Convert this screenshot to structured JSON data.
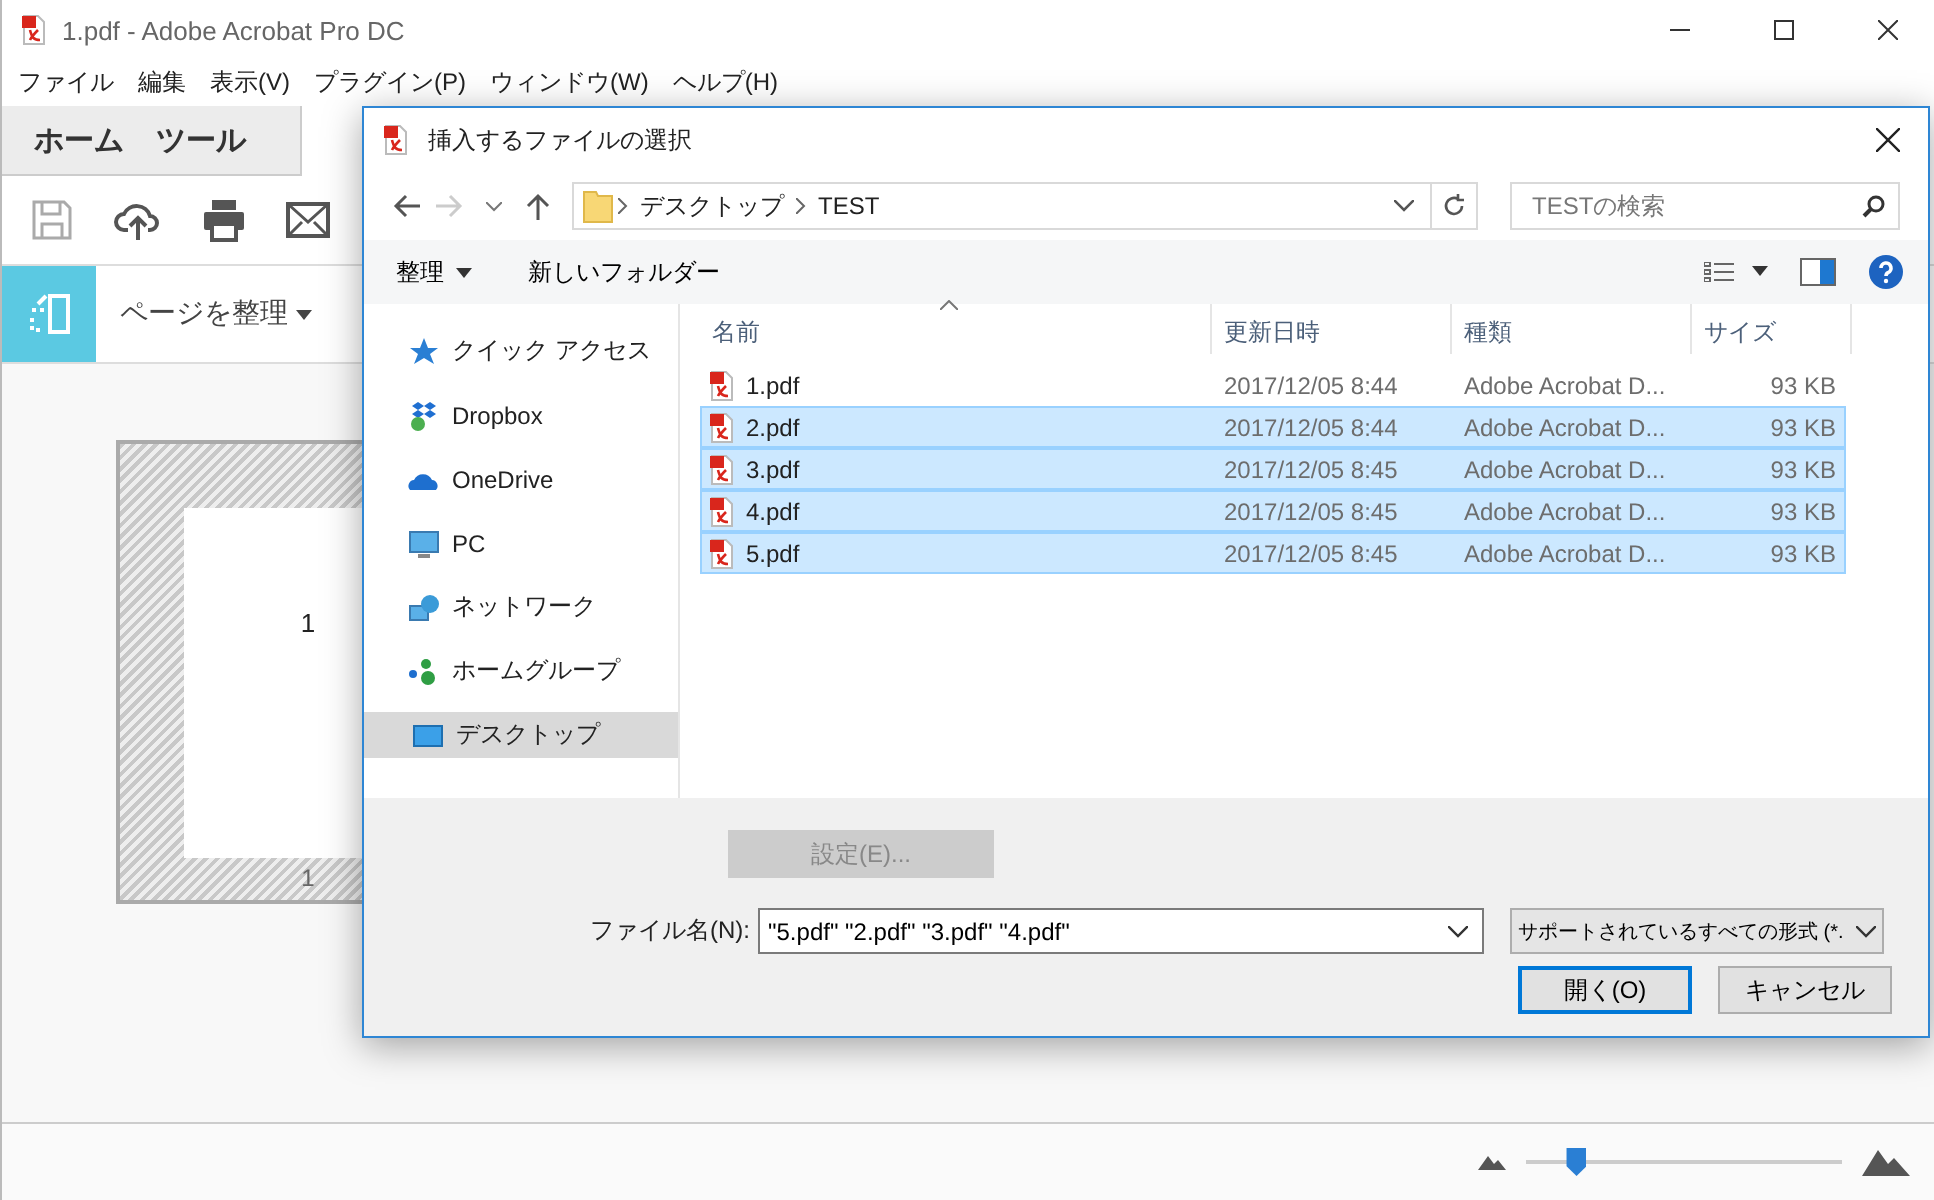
{
  "window": {
    "title": "1.pdf - Adobe Acrobat Pro DC"
  },
  "menu": [
    "ファイル",
    "編集",
    "表示(V)",
    "プラグイン(P)",
    "ウィンドウ(W)",
    "ヘルプ(H)"
  ],
  "tabs": [
    "ホーム",
    "ツール"
  ],
  "organize": {
    "label": "ページを整理"
  },
  "page_thumbnail": {
    "page_number": "1",
    "label": "1"
  },
  "dialog": {
    "title": "挿入するファイルの選択",
    "address": [
      "デスクトップ",
      "TEST"
    ],
    "search": {
      "placeholder": "TESTの検索"
    },
    "toolbar": {
      "organize": "整理",
      "new_folder": "新しいフォルダー"
    },
    "nav": [
      {
        "label": "クイック アクセス",
        "selected": false
      },
      {
        "label": "Dropbox",
        "selected": false
      },
      {
        "label": "OneDrive",
        "selected": false
      },
      {
        "label": "PC",
        "selected": false
      },
      {
        "label": "ネットワーク",
        "selected": false
      },
      {
        "label": "ホームグループ",
        "selected": false
      },
      {
        "label": "デスクトップ",
        "selected": true
      }
    ],
    "columns": [
      "名前",
      "更新日時",
      "種類",
      "サイズ"
    ],
    "rows": [
      {
        "name": "1.pdf",
        "date": "2017/12/05 8:44",
        "type": "Adobe Acrobat D...",
        "size": "93 KB",
        "selected": false
      },
      {
        "name": "2.pdf",
        "date": "2017/12/05 8:44",
        "type": "Adobe Acrobat D...",
        "size": "93 KB",
        "selected": true
      },
      {
        "name": "3.pdf",
        "date": "2017/12/05 8:45",
        "type": "Adobe Acrobat D...",
        "size": "93 KB",
        "selected": true
      },
      {
        "name": "4.pdf",
        "date": "2017/12/05 8:45",
        "type": "Adobe Acrobat D...",
        "size": "93 KB",
        "selected": true
      },
      {
        "name": "5.pdf",
        "date": "2017/12/05 8:45",
        "type": "Adobe Acrobat D...",
        "size": "93 KB",
        "selected": true
      }
    ],
    "settings_button": {
      "label": "設定(E)...",
      "disabled": true
    },
    "filename": {
      "label": "ファイル名(N):",
      "value": "\"5.pdf\" \"2.pdf\" \"3.pdf\" \"4.pdf\""
    },
    "filetype": {
      "value": "サポートされているすべての形式 (*."
    },
    "buttons": [
      {
        "label": "開く(O)",
        "default": true
      },
      {
        "label": "キャンセル",
        "default": false
      }
    ]
  },
  "status_bar": {
    "zoom": {
      "level": 0.16
    }
  }
}
